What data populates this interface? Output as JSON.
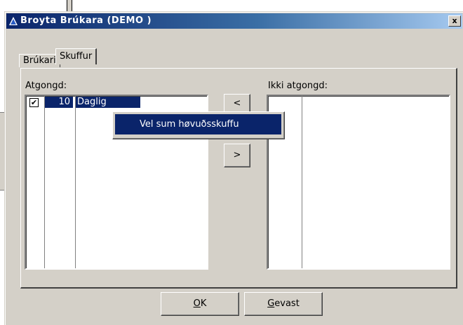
{
  "window": {
    "title": "Broyta Brúkara (DEMO )",
    "close_label": "x"
  },
  "tabs": [
    {
      "label": "Brúkari"
    },
    {
      "label": "Skuffur"
    }
  ],
  "panel": {
    "granted_label": "Atgongd:",
    "not_granted_label": "Ikki atgongd:",
    "granted_rows": [
      {
        "checked": true,
        "check_glyph": "✔",
        "number": "10",
        "name": "Daglig"
      }
    ],
    "move_right_label": ">",
    "move_left_label": "<"
  },
  "context_menu": {
    "item": "Vel sum høvuðsskuffu"
  },
  "buttons": {
    "ok_accel": "O",
    "ok_rest": "K",
    "cancel_accel": "G",
    "cancel_rest": "evast"
  }
}
